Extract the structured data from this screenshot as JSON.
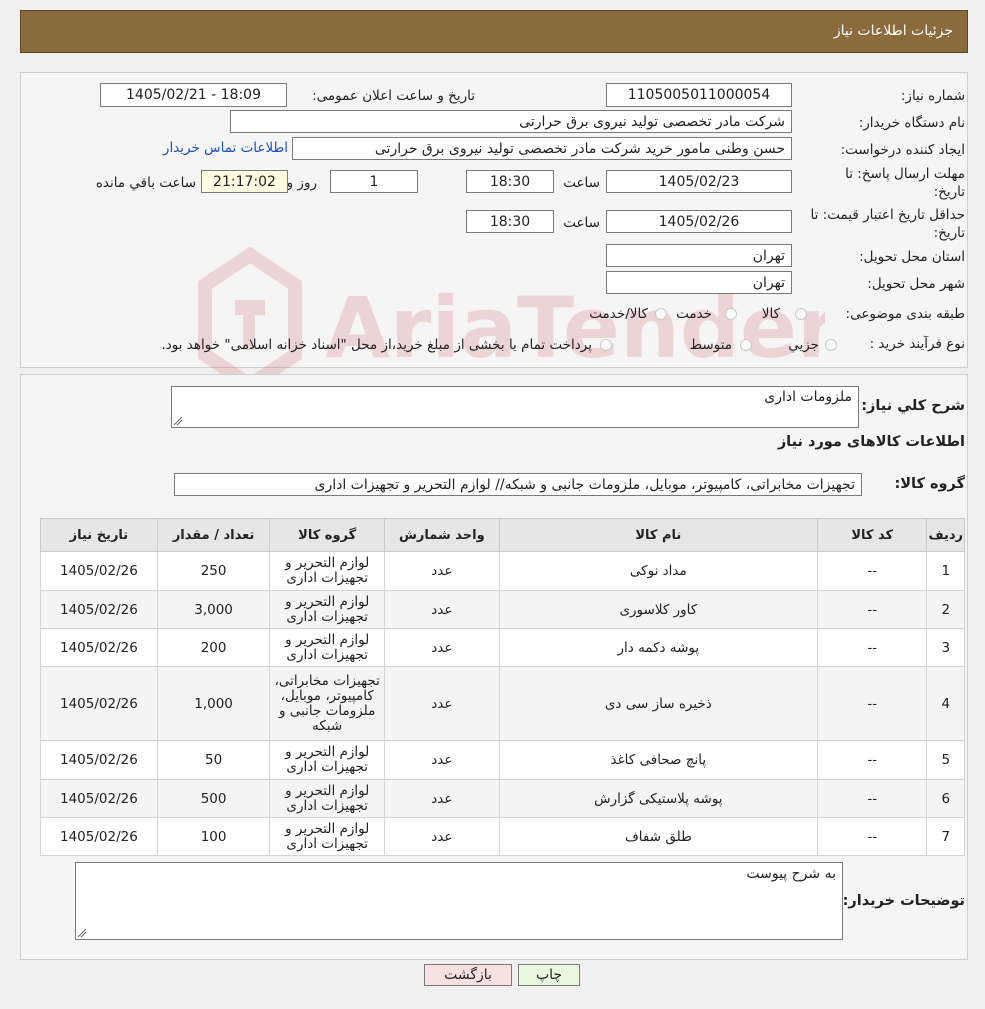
{
  "header": {
    "title": "جزئیات اطلاعات نیاز"
  },
  "form": {
    "need_number_label": "شماره نیاز:",
    "need_number": "1105005011000054",
    "announce_label": "تاریخ و ساعت اعلان عمومی:",
    "announce_value": "1405/02/21 - 18:09",
    "buyer_org_label": "نام دستگاه خریدار:",
    "buyer_org": "شرکت مادر تخصصی تولید نیروی برق حرارتی",
    "creator_label": "ایجاد کننده درخواست:",
    "creator": "حسن وطنی مامور خرید شرکت مادر تخصصی تولید نیروی برق حرارتی",
    "contact_link": "اطلاعات تماس خریدار",
    "deadline_label_1": "مهلت ارسال پاسخ: تا",
    "deadline_label_2": "تاریخ:",
    "deadline_date": "1405/02/23",
    "time_label": "ساعت",
    "deadline_time": "18:30",
    "days_value": "1",
    "days_label": "روز و",
    "remaining_time": "21:17:02",
    "remaining_label": "ساعت باقي مانده",
    "validity_label_1": "حداقل تاریخ اعتبار قیمت: تا",
    "validity_label_2": "تاریخ:",
    "validity_date": "1405/02/26",
    "validity_time_label": "ساعت",
    "validity_time": "18:30",
    "province_label": "استان محل تحویل:",
    "province": "تهران",
    "city_label": "شهر محل تحویل:",
    "city": "تهران",
    "category_label": "طبقه بندی موضوعی:",
    "category_options": [
      "کالا",
      "خدمت",
      "کالا/خدمت"
    ],
    "purchase_type_label": "نوع فرآیند خرید :",
    "purchase_options": [
      "جزیي",
      "متوسط"
    ],
    "purchase_note": "پرداخت تمام یا بخشی از مبلغ خرید،از محل \"اسناد خزانه اسلامی\" خواهد بود."
  },
  "summary": {
    "label": "شرح کلي نياز:",
    "value": "ملزومات اداری",
    "goods_title": "اطلاعات کالاهای مورد نياز",
    "group_label": "گروه کالا:",
    "group_value": "تجهیزات مخابراتی، کامپیوتر، موبایل، ملزومات جانبی و شبکه// لوازم التحریر و تجهیزات اداری"
  },
  "table": {
    "headers": [
      "رديف",
      "کد کالا",
      "نام کالا",
      "واحد شمارش",
      "گروه کالا",
      "تعداد / مقدار",
      "تاريخ نياز"
    ],
    "rows": [
      [
        "1",
        "--",
        "مداد نوکی",
        "عدد",
        "لوازم التحریر و تجهیزات اداری",
        "250",
        "1405/02/26"
      ],
      [
        "2",
        "--",
        "کاور کلاسوری",
        "عدد",
        "لوازم التحریر و تجهیزات اداری",
        "3,000",
        "1405/02/26"
      ],
      [
        "3",
        "--",
        "پوشه دکمه دار",
        "عدد",
        "لوازم التحریر و تجهیزات اداری",
        "200",
        "1405/02/26"
      ],
      [
        "4",
        "--",
        "ذخیره ساز سی دی",
        "عدد",
        "تجهیزات مخابراتی، کامپیوتر، موبایل، ملزومات جانبی و شبکه",
        "1,000",
        "1405/02/26"
      ],
      [
        "5",
        "--",
        "پانچ صحافی کاغذ",
        "عدد",
        "لوازم التحریر و تجهیزات اداری",
        "50",
        "1405/02/26"
      ],
      [
        "6",
        "--",
        "پوشه پلاستیکی گزارش",
        "عدد",
        "لوازم التحریر و تجهیزات اداری",
        "500",
        "1405/02/26"
      ],
      [
        "7",
        "--",
        "طلق شفاف",
        "عدد",
        "لوازم التحریر و تجهیزات اداری",
        "100",
        "1405/02/26"
      ]
    ]
  },
  "buyer_notes": {
    "label": "توضیحات خریدار:",
    "value": "به شرح پیوست"
  },
  "buttons": {
    "print": "چاپ",
    "back": "بازگشت"
  },
  "watermark": {
    "text": "AriaTender.neT"
  },
  "colors": {
    "header": "#8b6a3c",
    "link": "#1a50c0",
    "print_button": "#e8f8e0",
    "back_button": "#fbe0e0"
  }
}
